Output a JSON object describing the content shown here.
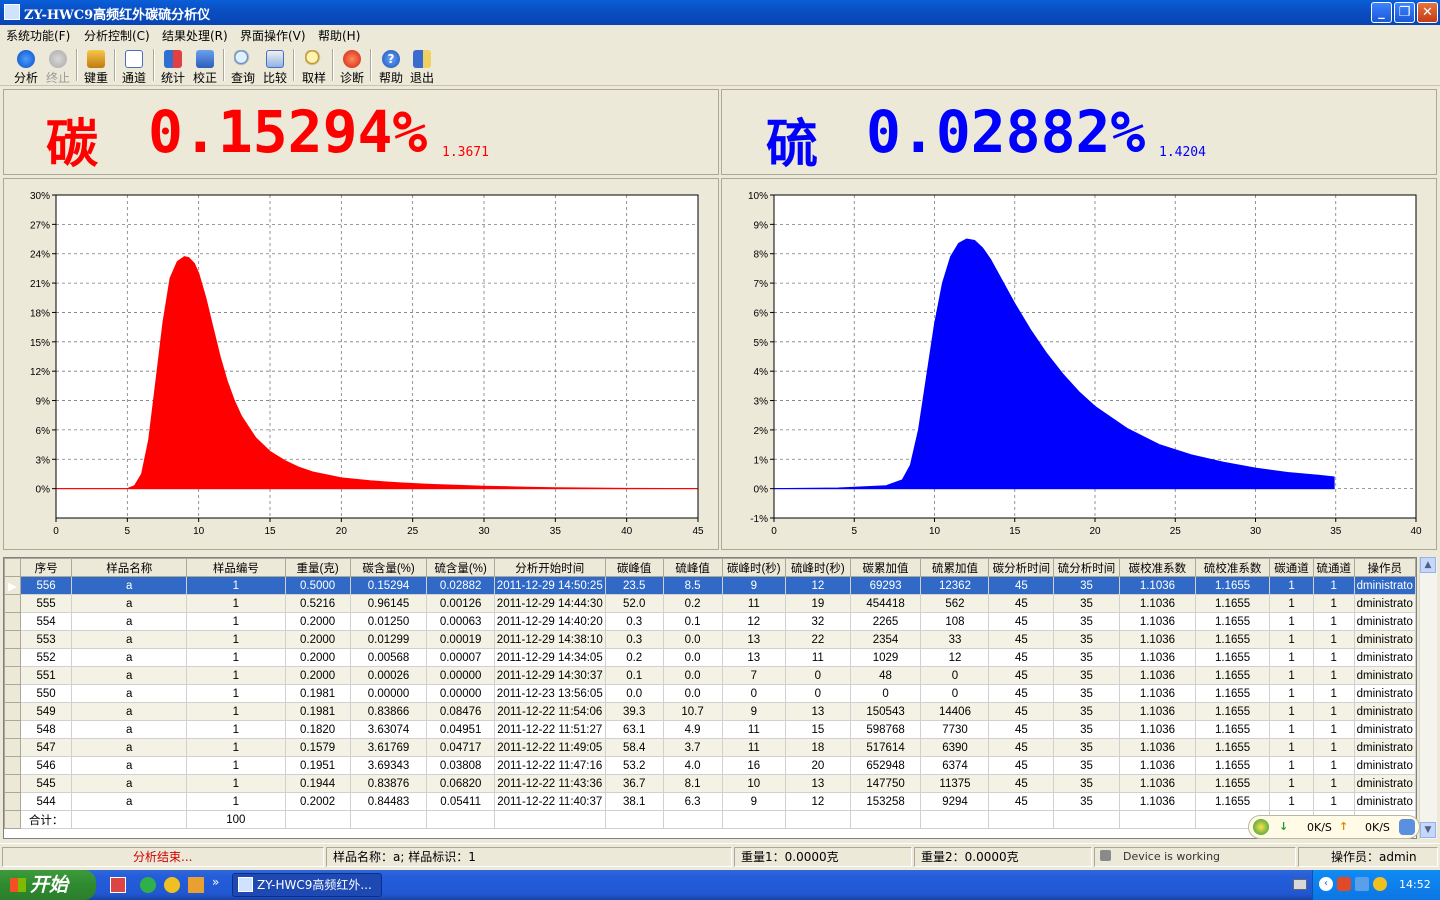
{
  "window": {
    "title": "ZY-HWC9高频红外碳硫分析仪",
    "controls": [
      "minimize",
      "restore",
      "close"
    ]
  },
  "menu": [
    "系统功能(F)",
    "分析控制(C)",
    "结果处理(R)",
    "界面操作(V)",
    "帮助(H)"
  ],
  "toolbar": [
    {
      "label": "分析",
      "icon": "play-icon",
      "enabled": true
    },
    {
      "label": "终止",
      "icon": "stop-icon",
      "enabled": false
    },
    {
      "label": "键重",
      "icon": "weight-icon",
      "enabled": true
    },
    {
      "label": "通道",
      "icon": "channel-icon",
      "enabled": true
    },
    {
      "label": "统计",
      "icon": "statistics-icon",
      "enabled": true
    },
    {
      "label": "校正",
      "icon": "calibrate-icon",
      "enabled": true
    },
    {
      "label": "查询",
      "icon": "search-icon",
      "enabled": true
    },
    {
      "label": "比较",
      "icon": "compare-icon",
      "enabled": true
    },
    {
      "label": "取样",
      "icon": "sample-icon",
      "enabled": true
    },
    {
      "label": "诊断",
      "icon": "diagnose-icon",
      "enabled": true
    },
    {
      "label": "帮助",
      "icon": "help-icon",
      "enabled": true
    },
    {
      "label": "退出",
      "icon": "exit-icon",
      "enabled": true
    }
  ],
  "carbon": {
    "element": "碳",
    "value": "0.15294%",
    "sub": "1.3671",
    "color": "#ff0000"
  },
  "sulfur": {
    "element": "硫",
    "value": "0.02882%",
    "sub": "1.4204",
    "color": "#0000ff"
  },
  "chart_data": [
    {
      "type": "area",
      "series_color": "#ff0000",
      "xlim": [
        0,
        45
      ],
      "ylim": [
        -3,
        30
      ],
      "x_ticks": [
        0,
        5,
        10,
        15,
        20,
        25,
        30,
        35,
        40,
        45
      ],
      "y_ticks": [
        "0%",
        "3%",
        "6%",
        "9%",
        "12%",
        "15%",
        "18%",
        "21%",
        "24%",
        "27%",
        "30%"
      ],
      "grid": true,
      "x": [
        0,
        5,
        5.5,
        6,
        6.5,
        7,
        7.5,
        8,
        8.5,
        9,
        9.3,
        9.7,
        10,
        10.5,
        11,
        11.5,
        12,
        12.5,
        13,
        14,
        15,
        16,
        17,
        18,
        20,
        22,
        24,
        26,
        28,
        30,
        33,
        35,
        38,
        40,
        45
      ],
      "y": [
        0,
        0,
        0.3,
        1.5,
        5,
        11,
        17,
        21.5,
        23.2,
        23.7,
        23.6,
        23,
        22,
        19.5,
        16.5,
        13.5,
        11,
        9,
        7.4,
        5.2,
        3.8,
        2.9,
        2.2,
        1.7,
        1.1,
        0.8,
        0.6,
        0.45,
        0.35,
        0.25,
        0.15,
        0.1,
        0.05,
        0.02,
        0
      ]
    },
    {
      "type": "area",
      "series_color": "#0000ff",
      "xlim": [
        0,
        40
      ],
      "ylim": [
        -1,
        10
      ],
      "x_ticks": [
        0,
        5,
        10,
        15,
        20,
        25,
        30,
        35,
        40
      ],
      "y_ticks": [
        "-1%",
        "0%",
        "1%",
        "2%",
        "3%",
        "4%",
        "5%",
        "6%",
        "7%",
        "8%",
        "9%",
        "10%"
      ],
      "grid": true,
      "x": [
        0,
        4,
        7,
        8,
        8.5,
        9,
        9.5,
        10,
        10.5,
        11,
        11.5,
        12,
        12.5,
        13,
        13.5,
        14,
        15,
        16,
        17,
        18,
        19,
        20,
        22,
        24,
        26,
        28,
        30,
        32,
        34,
        34.9
      ],
      "y": [
        0,
        0.02,
        0.1,
        0.3,
        0.8,
        2,
        3.8,
        5.6,
        7,
        7.9,
        8.35,
        8.5,
        8.45,
        8.2,
        7.8,
        7.3,
        6.3,
        5.4,
        4.6,
        3.9,
        3.3,
        2.8,
        2.05,
        1.5,
        1.15,
        0.9,
        0.7,
        0.55,
        0.45,
        0.4
      ]
    }
  ],
  "table": {
    "columns": [
      "序号",
      "样品名称",
      "样品编号",
      "重量(克)",
      "碳含量(%)",
      "硫含量(%)",
      "分析开始时间",
      "碳峰值",
      "硫峰值",
      "碳峰时(秒)",
      "硫峰时(秒)",
      "碳累加值",
      "硫累加值",
      "碳分析时间",
      "硫分析时间",
      "碳校准系数",
      "硫校准系数",
      "碳通道",
      "硫通道",
      "操作员"
    ],
    "rows": [
      [
        "556",
        "a",
        "1",
        "0.5000",
        "0.15294",
        "0.02882",
        "2011-12-29 14:50:25",
        "23.5",
        "8.5",
        "9",
        "12",
        "69293",
        "12362",
        "45",
        "35",
        "1.1036",
        "1.1655",
        "1",
        "1",
        "dministrato"
      ],
      [
        "555",
        "a",
        "1",
        "0.5216",
        "0.96145",
        "0.00126",
        "2011-12-29 14:44:30",
        "52.0",
        "0.2",
        "11",
        "19",
        "454418",
        "562",
        "45",
        "35",
        "1.1036",
        "1.1655",
        "1",
        "1",
        "dministrato"
      ],
      [
        "554",
        "a",
        "1",
        "0.2000",
        "0.01250",
        "0.00063",
        "2011-12-29 14:40:20",
        "0.3",
        "0.1",
        "12",
        "32",
        "2265",
        "108",
        "45",
        "35",
        "1.1036",
        "1.1655",
        "1",
        "1",
        "dministrato"
      ],
      [
        "553",
        "a",
        "1",
        "0.2000",
        "0.01299",
        "0.00019",
        "2011-12-29 14:38:10",
        "0.3",
        "0.0",
        "13",
        "22",
        "2354",
        "33",
        "45",
        "35",
        "1.1036",
        "1.1655",
        "1",
        "1",
        "dministrato"
      ],
      [
        "552",
        "a",
        "1",
        "0.2000",
        "0.00568",
        "0.00007",
        "2011-12-29 14:34:05",
        "0.2",
        "0.0",
        "13",
        "11",
        "1029",
        "12",
        "45",
        "35",
        "1.1036",
        "1.1655",
        "1",
        "1",
        "dministrato"
      ],
      [
        "551",
        "a",
        "1",
        "0.2000",
        "0.00026",
        "0.00000",
        "2011-12-29 14:30:37",
        "0.1",
        "0.0",
        "7",
        "0",
        "48",
        "0",
        "45",
        "35",
        "1.1036",
        "1.1655",
        "1",
        "1",
        "dministrato"
      ],
      [
        "550",
        "a",
        "1",
        "0.1981",
        "0.00000",
        "0.00000",
        "2011-12-23 13:56:05",
        "0.0",
        "0.0",
        "0",
        "0",
        "0",
        "0",
        "45",
        "35",
        "1.1036",
        "1.1655",
        "1",
        "1",
        "dministrato"
      ],
      [
        "549",
        "a",
        "1",
        "0.1981",
        "0.83866",
        "0.08476",
        "2011-12-22 11:54:06",
        "39.3",
        "10.7",
        "9",
        "13",
        "150543",
        "14406",
        "45",
        "35",
        "1.1036",
        "1.1655",
        "1",
        "1",
        "dministrato"
      ],
      [
        "548",
        "a",
        "1",
        "0.1820",
        "3.63074",
        "0.04951",
        "2011-12-22 11:51:27",
        "63.1",
        "4.9",
        "11",
        "15",
        "598768",
        "7730",
        "45",
        "35",
        "1.1036",
        "1.1655",
        "1",
        "1",
        "dministrato"
      ],
      [
        "547",
        "a",
        "1",
        "0.1579",
        "3.61769",
        "0.04717",
        "2011-12-22 11:49:05",
        "58.4",
        "3.7",
        "11",
        "18",
        "517614",
        "6390",
        "45",
        "35",
        "1.1036",
        "1.1655",
        "1",
        "1",
        "dministrato"
      ],
      [
        "546",
        "a",
        "1",
        "0.1951",
        "3.69343",
        "0.03808",
        "2011-12-22 11:47:16",
        "53.2",
        "4.0",
        "16",
        "20",
        "652948",
        "6374",
        "45",
        "35",
        "1.1036",
        "1.1655",
        "1",
        "1",
        "dministrato"
      ],
      [
        "545",
        "a",
        "1",
        "0.1944",
        "0.83876",
        "0.06820",
        "2011-12-22 11:43:36",
        "36.7",
        "8.1",
        "10",
        "13",
        "147750",
        "11375",
        "45",
        "35",
        "1.1036",
        "1.1655",
        "1",
        "1",
        "dministrato"
      ],
      [
        "544",
        "a",
        "1",
        "0.2002",
        "0.84483",
        "0.05411",
        "2011-12-22 11:40:37",
        "38.1",
        "6.3",
        "9",
        "12",
        "153258",
        "9294",
        "45",
        "35",
        "1.1036",
        "1.1655",
        "1",
        "1",
        "dministrato"
      ]
    ],
    "total_label": "合计：",
    "total_value": "100"
  },
  "netspeed": {
    "down": "0K/S",
    "up": "0K/S"
  },
  "status": {
    "message": "分析结束...",
    "sample": "样品名称：a; 样品标识：1",
    "weight1": "重量1：0.0000克",
    "weight2": "重量2：0.0000克",
    "device": "Device is working",
    "operator": "操作员：admin"
  },
  "taskbar": {
    "start": "开始",
    "app": "ZY-HWC9高频红外...",
    "time": "14:52"
  }
}
